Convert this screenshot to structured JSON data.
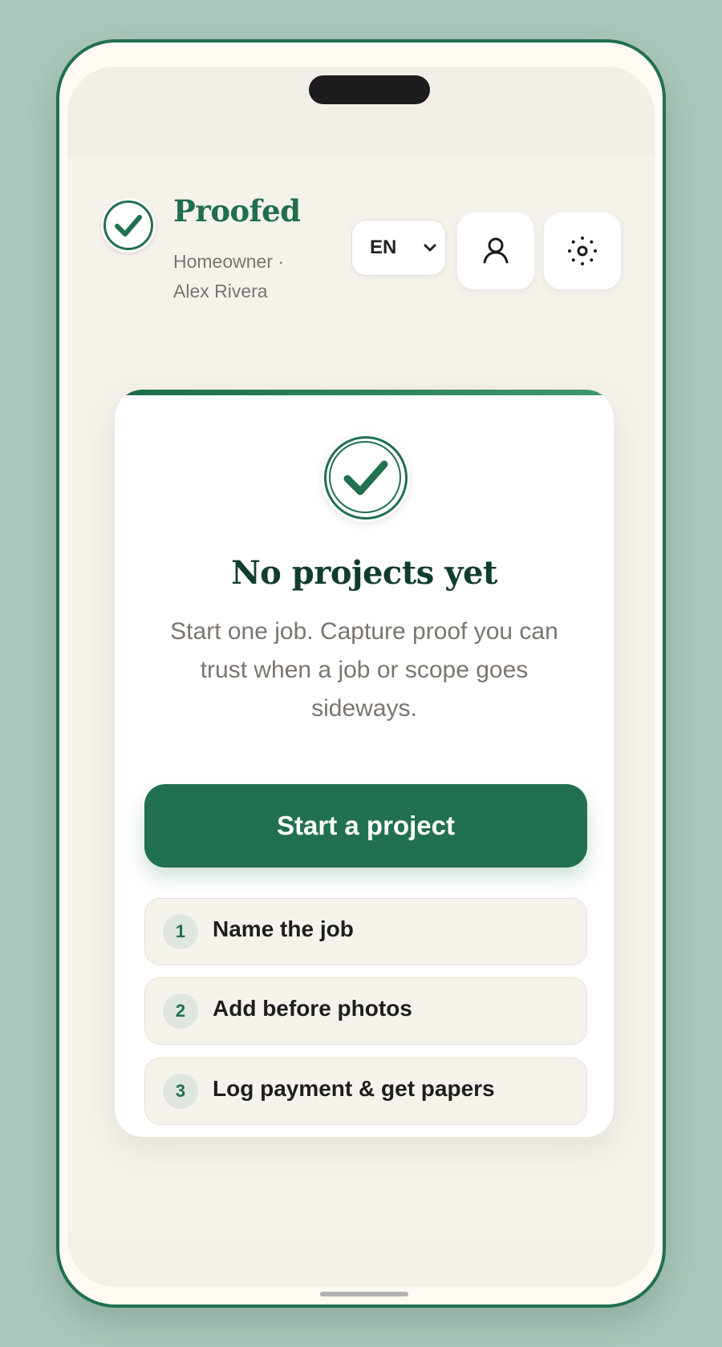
{
  "header": {
    "brand": "Proofed",
    "subline": "Homeowner · Alex Rivera",
    "language": "EN"
  },
  "empty_state": {
    "title": "No projects yet",
    "description": "Start one job. Capture proof you can trust when a job or scope goes sideways.",
    "cta_label": "Start a project",
    "steps": [
      {
        "number": "1",
        "label": "Name the job"
      },
      {
        "number": "2",
        "label": "Add before photos"
      },
      {
        "number": "3",
        "label": "Log payment & get papers"
      }
    ]
  },
  "icons": [
    "check-icon",
    "chevron-down-icon",
    "user-icon",
    "sun-icon"
  ],
  "colors": {
    "brand": "#217050",
    "background": "#a9c7ba",
    "screen": "#f5f2ec",
    "title": "#123d2c"
  }
}
